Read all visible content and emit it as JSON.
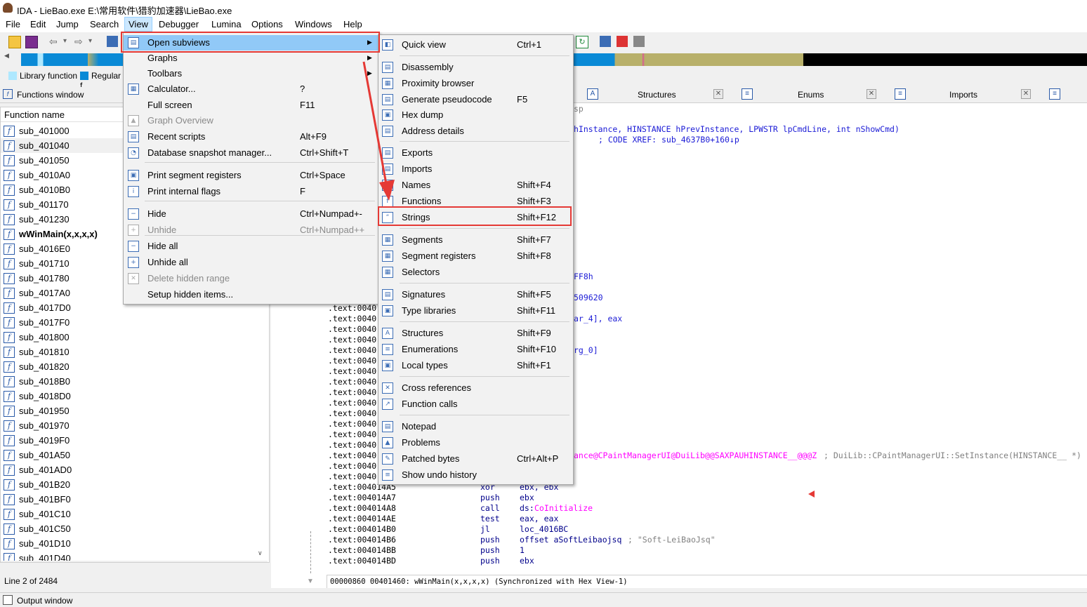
{
  "window": {
    "title": "IDA - LieBao.exe E:\\常用软件\\猎豹加速器\\LieBao.exe"
  },
  "menubar": [
    {
      "label": "File"
    },
    {
      "label": "Edit"
    },
    {
      "label": "Jump"
    },
    {
      "label": "Search"
    },
    {
      "label": "View"
    },
    {
      "label": "Debugger"
    },
    {
      "label": "Lumina"
    },
    {
      "label": "Options"
    },
    {
      "label": "Windows"
    },
    {
      "label": "Help"
    }
  ],
  "legend": {
    "library": "Library function",
    "regular": "Regular f"
  },
  "functions_window": {
    "title": "Functions window",
    "column": "Function name",
    "items": [
      "sub_401000",
      "sub_401040",
      "sub_401050",
      "sub_4010A0",
      "sub_4010B0",
      "sub_401170",
      "sub_401230",
      "wWinMain(x,x,x,x)",
      "sub_4016E0",
      "sub_401710",
      "sub_401780",
      "sub_4017A0",
      "sub_4017D0",
      "sub_4017F0",
      "sub_401800",
      "sub_401810",
      "sub_401820",
      "sub_4018B0",
      "sub_4018D0",
      "sub_401950",
      "sub_401970",
      "sub_4019F0",
      "sub_401A50",
      "sub_401AD0",
      "sub_401B20",
      "sub_401BF0",
      "sub_401C10",
      "sub_401C50",
      "sub_401D10",
      "sub_401D40"
    ],
    "status": "Line 2 of 2484"
  },
  "tabs": [
    {
      "label": "Structures"
    },
    {
      "label": "Enums"
    },
    {
      "label": "Imports"
    }
  ],
  "view_menu": [
    {
      "label": "Open subviews",
      "shortcut": "",
      "icon": "open-subviews-icon",
      "submenu": true
    },
    {
      "label": "Graphs",
      "shortcut": "",
      "submenu": true
    },
    {
      "label": "Toolbars",
      "shortcut": "",
      "submenu": true
    },
    {
      "label": "Calculator...",
      "shortcut": "?",
      "icon": "calculator-icon"
    },
    {
      "label": "Full screen",
      "shortcut": "F11"
    },
    {
      "label": "Graph Overview",
      "shortcut": "",
      "icon": "graph-overview-icon",
      "disabled": true
    },
    {
      "label": "Recent scripts",
      "shortcut": "Alt+F9",
      "icon": "scripts-icon"
    },
    {
      "label": "Database snapshot manager...",
      "shortcut": "Ctrl+Shift+T",
      "icon": "snapshot-icon"
    },
    {
      "label": "Print segment registers",
      "shortcut": "Ctrl+Space",
      "icon": "segment-registers-icon"
    },
    {
      "label": "Print internal flags",
      "shortcut": "F",
      "icon": "info-icon"
    },
    {
      "label": "Hide",
      "shortcut": "Ctrl+Numpad+-",
      "icon": "hide-icon"
    },
    {
      "label": "Unhide",
      "shortcut": "Ctrl+Numpad++",
      "icon": "unhide-icon",
      "disabled": true
    },
    {
      "label": "Hide all",
      "shortcut": "",
      "icon": "hide-all-icon"
    },
    {
      "label": "Unhide all",
      "shortcut": "",
      "icon": "unhide-all-icon"
    },
    {
      "label": "Delete hidden range",
      "shortcut": "",
      "icon": "delete-icon",
      "disabled": true
    },
    {
      "label": "Setup hidden items...",
      "shortcut": ""
    }
  ],
  "subviews_menu": [
    {
      "label": "Quick view",
      "shortcut": "Ctrl+1"
    },
    {
      "label": "Disassembly",
      "shortcut": ""
    },
    {
      "label": "Proximity browser",
      "shortcut": ""
    },
    {
      "label": "Generate pseudocode",
      "shortcut": "F5"
    },
    {
      "label": "Hex dump",
      "shortcut": ""
    },
    {
      "label": "Address details",
      "shortcut": ""
    },
    {
      "label": "Exports",
      "shortcut": ""
    },
    {
      "label": "Imports",
      "shortcut": ""
    },
    {
      "label": "Names",
      "shortcut": "Shift+F4"
    },
    {
      "label": "Functions",
      "shortcut": "Shift+F3"
    },
    {
      "label": "Strings",
      "shortcut": "Shift+F12"
    },
    {
      "label": "Segments",
      "shortcut": "Shift+F7"
    },
    {
      "label": "Segment registers",
      "shortcut": "Shift+F8"
    },
    {
      "label": "Selectors",
      "shortcut": ""
    },
    {
      "label": "Signatures",
      "shortcut": "Shift+F5"
    },
    {
      "label": "Type libraries",
      "shortcut": "Shift+F11"
    },
    {
      "label": "Structures",
      "shortcut": "Shift+F9"
    },
    {
      "label": "Enumerations",
      "shortcut": "Shift+F10"
    },
    {
      "label": "Local types",
      "shortcut": "Shift+F1"
    },
    {
      "label": "Cross references",
      "shortcut": ""
    },
    {
      "label": "Function calls",
      "shortcut": ""
    },
    {
      "label": "Notepad",
      "shortcut": ""
    },
    {
      "label": "Problems",
      "shortcut": ""
    },
    {
      "label": "Patched bytes",
      "shortcut": "Ctrl+Alt+P"
    },
    {
      "label": "Show undo history",
      "shortcut": ""
    }
  ],
  "code": {
    "header_frag": "sp",
    "sig_line": "hInstance, HINSTANCE hPrevInstance, LPWSTR lpCmdLine, int nShowCmd)",
    "xref_line": "; CODE XREF: sub_4637B0+160↓p",
    "frag1": "FF8h",
    "frag2": "509620",
    "frag3": "ar_4], eax",
    "frag4": "rg_0]",
    "call_line": "ance@CPaintManagerUI@DuiLib@@SAXPAUHINSTANCE__@@@Z",
    "call_comment": "; DuiLib::CPaintManagerUI::SetInstance(HINSTANCE__ *)",
    "text_prefix": ".text:0040",
    "lines": [
      {
        "addr": ".text:004014A5",
        "mn": "xor",
        "op": "ebx, ebx"
      },
      {
        "addr": ".text:004014A7",
        "mn": "push",
        "op": "ebx"
      },
      {
        "addr": ".text:004014A8",
        "mn": "call",
        "op": "ds:",
        "op2": "CoInitialize"
      },
      {
        "addr": ".text:004014AE",
        "mn": "test",
        "op": "eax, eax"
      },
      {
        "addr": ".text:004014B0",
        "mn": "jl",
        "op": "loc_4016BC"
      },
      {
        "addr": ".text:004014B6",
        "mn": "push",
        "op": "offset aSoftLeibaojsq",
        "cmt": "; \"Soft-LeiBaoJsq\""
      },
      {
        "addr": ".text:004014BB",
        "mn": "push",
        "op": "1"
      },
      {
        "addr": ".text:004014BD",
        "mn": "push",
        "op": "ebx"
      }
    ],
    "status_bar": "00000860 00401460: wWinMain(x,x,x,x) (Synchronized with Hex View-1)"
  },
  "output_window": "Output window",
  "colors": {
    "selection": "#91c9f7",
    "annotation": "#e53935",
    "library": "#aee8ff",
    "regular": "#0a8ad6"
  }
}
